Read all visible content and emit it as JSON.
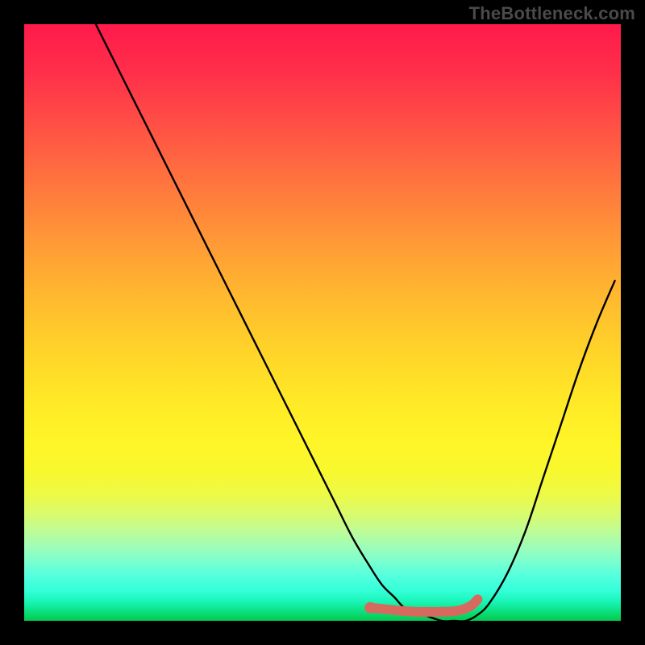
{
  "watermark": "TheBottleneck.com",
  "chart_data": {
    "type": "line",
    "title": "",
    "xlabel": "",
    "ylabel": "",
    "x_range": [
      0,
      100
    ],
    "y_range": [
      0,
      100
    ],
    "series": [
      {
        "name": "bottleneck-curve",
        "color": "#000000",
        "x": [
          12,
          15,
          18,
          21,
          24,
          28,
          32,
          36,
          40,
          44,
          48,
          52,
          55,
          58,
          60,
          62,
          64,
          67,
          70,
          72,
          74,
          76,
          78,
          81,
          84,
          87,
          90,
          93,
          96,
          99
        ],
        "values": [
          100,
          94,
          88,
          82,
          76,
          68,
          60,
          52,
          44,
          36,
          28,
          20,
          14,
          9,
          6,
          4,
          2,
          1,
          0,
          0,
          0,
          1,
          3,
          8,
          15,
          24,
          33,
          42,
          50,
          57
        ]
      },
      {
        "name": "sweet-spot-segment",
        "color": "#d66a5e",
        "x": [
          58,
          60,
          62,
          64,
          66,
          68,
          70,
          72,
          73.5,
          75,
          76
        ],
        "values": [
          2.2,
          2.0,
          1.8,
          1.6,
          1.5,
          1.5,
          1.5,
          1.6,
          1.9,
          2.6,
          3.6
        ]
      }
    ],
    "marker": {
      "name": "sweet-spot-marker",
      "color": "#d66a5e",
      "x": 58,
      "y": 2.2
    }
  }
}
